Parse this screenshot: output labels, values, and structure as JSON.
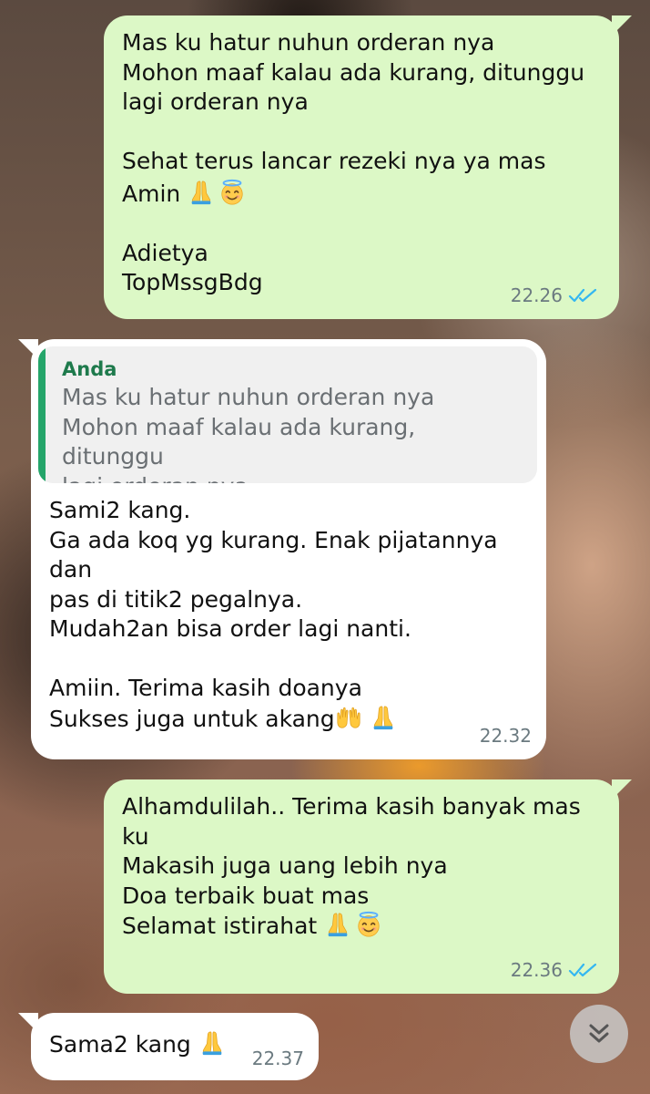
{
  "messages": [
    {
      "direction": "outgoing",
      "lines": [
        "Mas ku hatur nuhun orderan nya",
        "Mohon maaf kalau ada kurang, ditunggu",
        "lagi orderan nya",
        "",
        "Sehat terus lancar rezeki nya ya mas"
      ],
      "line_with_emoji": "Amin",
      "lines_after": [
        "",
        "Adietya",
        "TopMssgBdg"
      ],
      "emojis": [
        "praying-hands-icon",
        "smiling-halo-icon"
      ],
      "time": "22.26",
      "status": "read"
    },
    {
      "direction": "incoming",
      "quote": {
        "author": "Anda",
        "text": "Mas ku hatur nuhun orderan nya\nMohon maaf kalau ada kurang, ditunggu\nlagi orderan nya..."
      },
      "text": "Sami2 kang.\nGa ada koq yg kurang. Enak pijatannya dan\npas di titik2 pegalnya.\nMudah2an bisa order lagi nanti.\n\nAmiin. Terima kasih doanya\n",
      "last_line": "Sukses juga untuk akang",
      "emojis": [
        "raised-hands-icon",
        "praying-hands-icon"
      ],
      "time": "22.32"
    },
    {
      "direction": "outgoing",
      "text": "Alhamdulilah.. Terima kasih banyak mas\nku\nMakasih juga uang lebih nya\nDoa terbaik buat mas\n",
      "last_line": "Selamat istirahat",
      "emojis": [
        "praying-hands-icon",
        "smiling-halo-icon"
      ],
      "time": "22.36",
      "status": "read"
    },
    {
      "direction": "incoming",
      "text": "Sama2 kang",
      "emojis": [
        "praying-hands-icon"
      ],
      "time": "22.37"
    }
  ],
  "colors": {
    "outgoing_bubble": "#dcf8c6",
    "incoming_bubble": "#ffffff",
    "read_ticks": "#34b7f1",
    "quote_accent": "#25a56a"
  },
  "scroll_button": {
    "icon": "double-chevron-down-icon"
  }
}
